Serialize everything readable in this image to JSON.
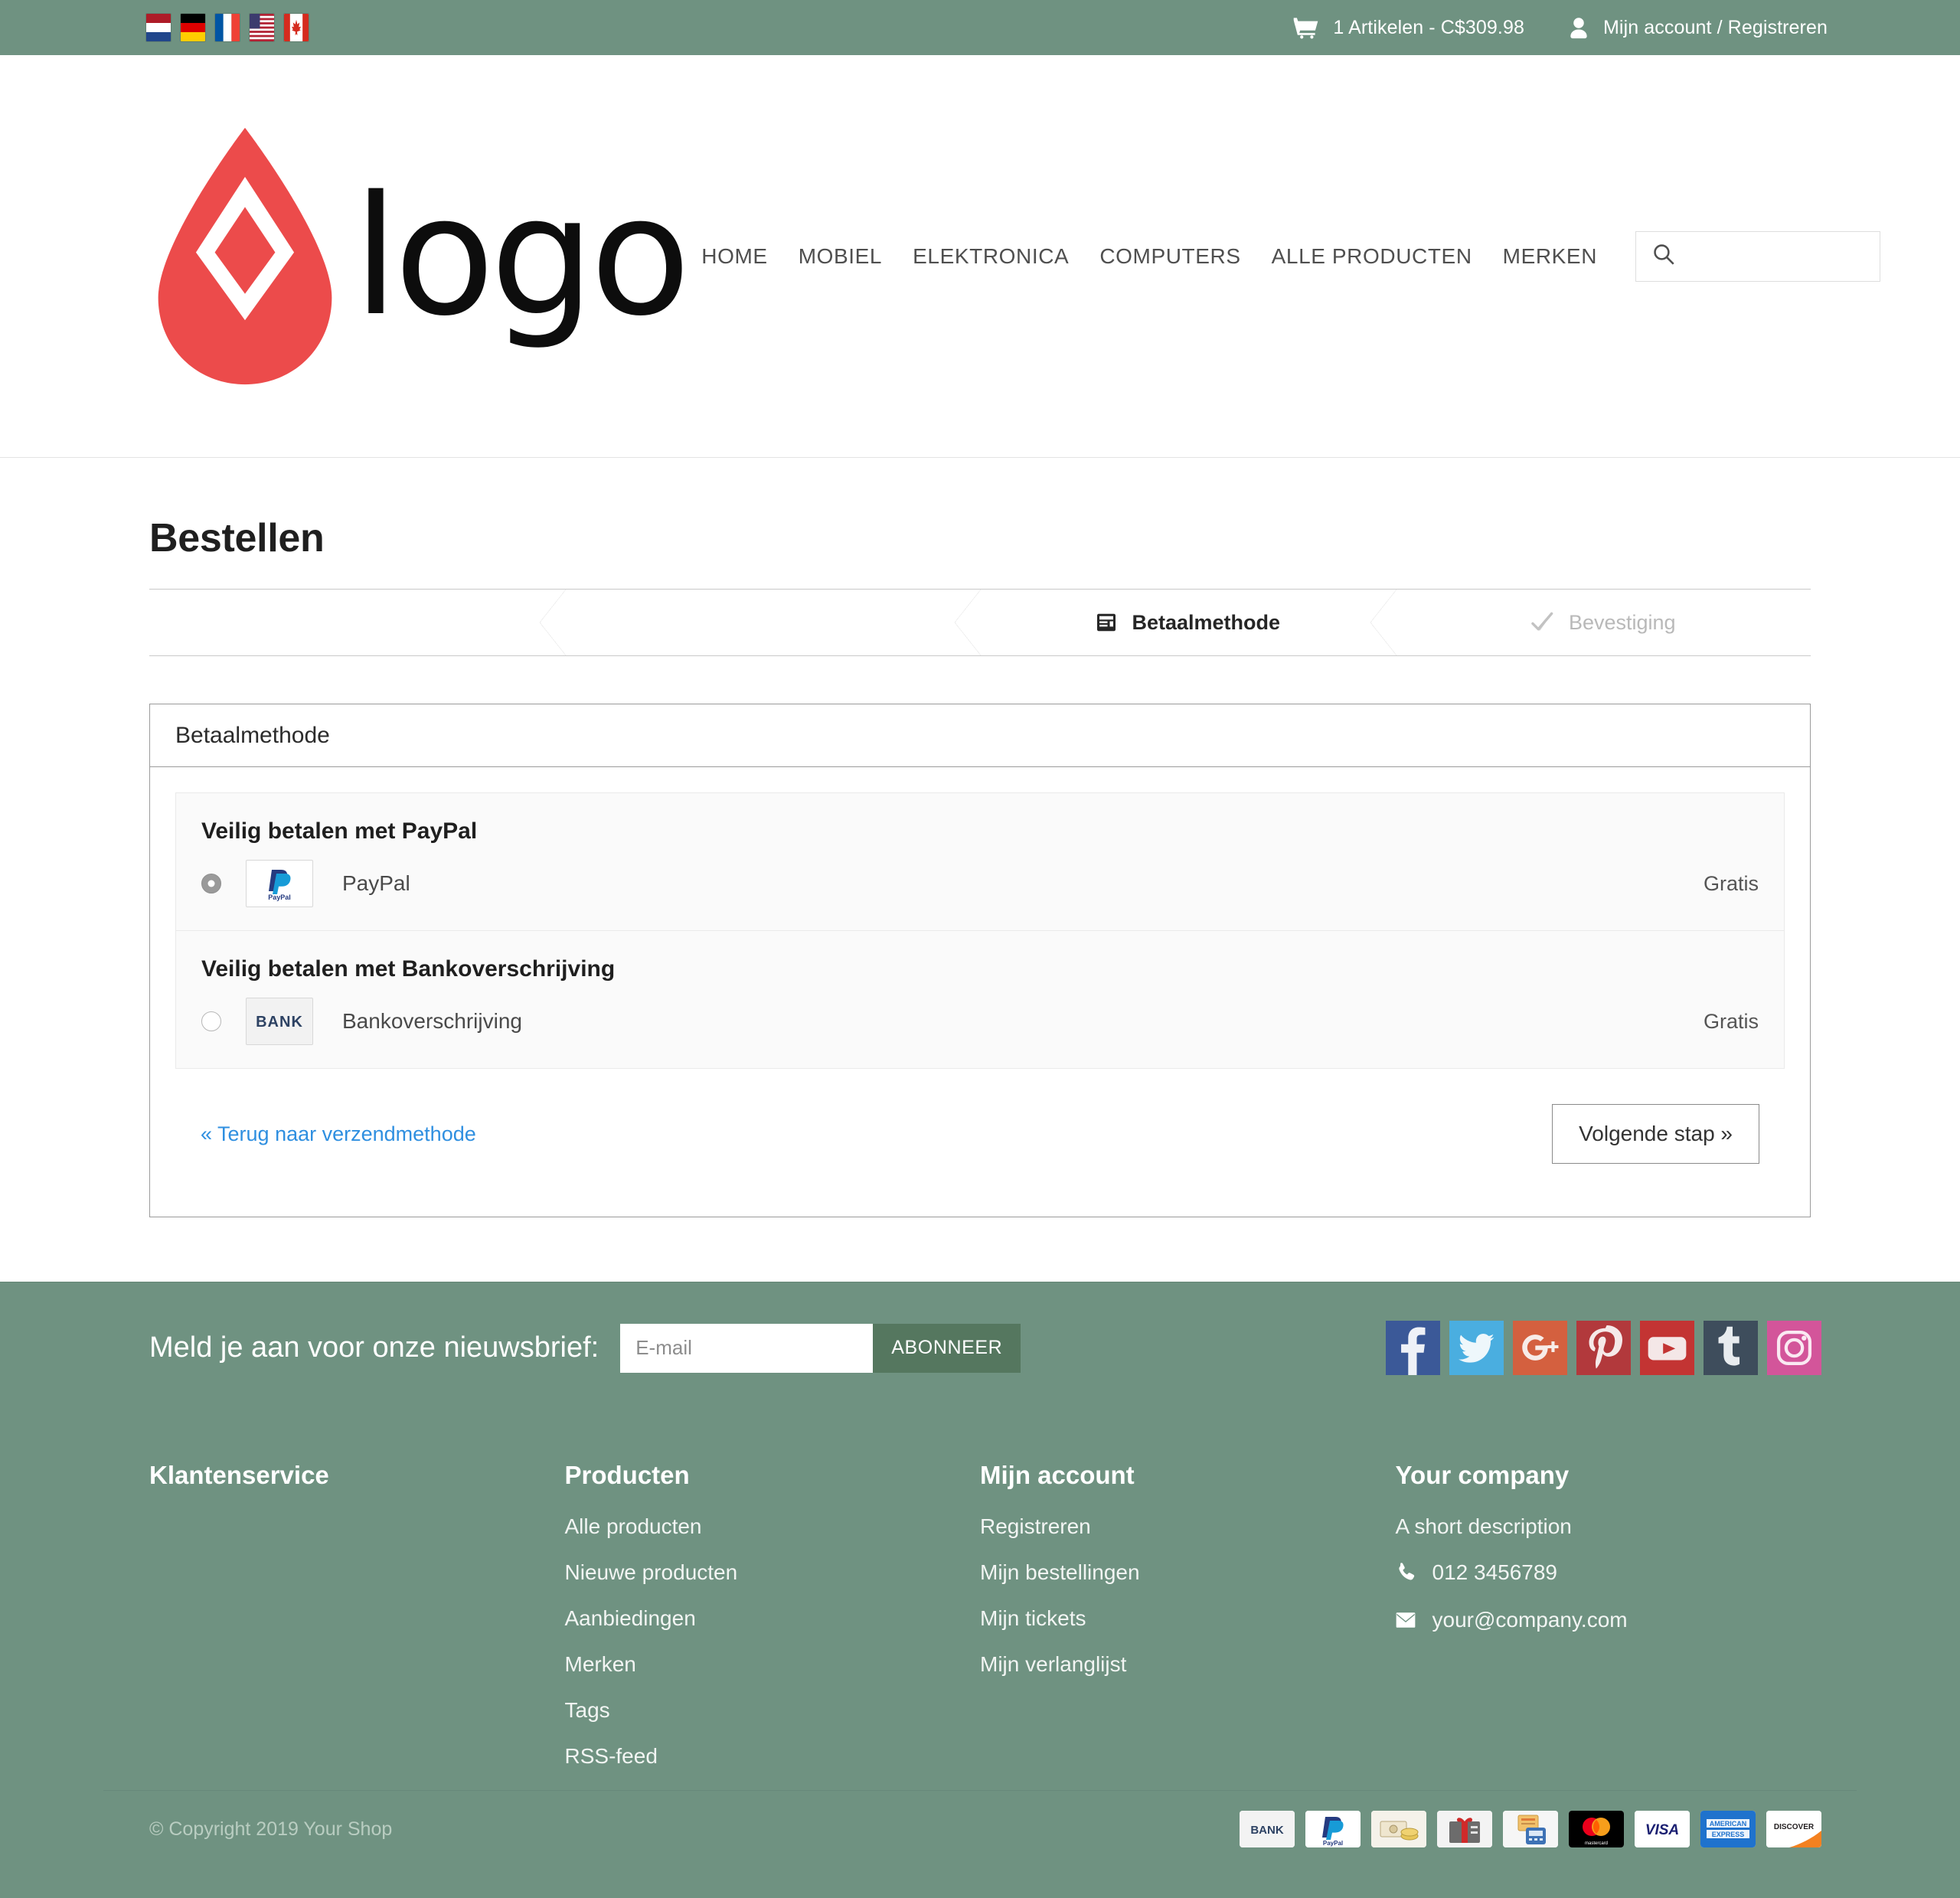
{
  "topbar": {
    "flags": [
      {
        "name": "flag-nl",
        "title": "Nederlands"
      },
      {
        "name": "flag-de",
        "title": "Deutsch"
      },
      {
        "name": "flag-fr",
        "title": "Français"
      },
      {
        "name": "flag-us",
        "title": "English"
      },
      {
        "name": "flag-ca",
        "title": "Canada"
      }
    ],
    "cart_icon": "cart-icon",
    "cart_text": "1 Artikelen - C$309.98",
    "account_icon": "user-icon",
    "account_text": "Mijn account / Registreren"
  },
  "header": {
    "logo_text": "logo",
    "logo_mark": "flame-logo-icon",
    "nav": [
      {
        "label": "HOME"
      },
      {
        "label": "MOBIEL"
      },
      {
        "label": "ELEKTRONICA"
      },
      {
        "label": "COMPUTERS"
      },
      {
        "label": "ALLE PRODUCTEN"
      },
      {
        "label": "MERKEN"
      }
    ],
    "search": {
      "icon": "search-icon",
      "placeholder": "",
      "value": ""
    }
  },
  "page": {
    "title": "Bestellen",
    "steps": [
      {
        "label": "",
        "state": "blank",
        "icon": ""
      },
      {
        "label": "",
        "state": "blank",
        "icon": ""
      },
      {
        "label": "Betaalmethode",
        "state": "active",
        "icon": "credit-card-icon"
      },
      {
        "label": "Bevestiging",
        "state": "muted",
        "icon": "check-icon"
      }
    ],
    "panel": {
      "heading": "Betaalmethode",
      "groups": [
        {
          "title": "Veilig betalen met PayPal",
          "methods": [
            {
              "id": "paypal",
              "label": "PayPal",
              "price": "Gratis",
              "selected": true,
              "logo": "paypal-logo",
              "logo_text": "PayPal"
            }
          ]
        },
        {
          "title": "Veilig betalen met Bankoverschrijving",
          "methods": [
            {
              "id": "bank",
              "label": "Bankoverschrijving",
              "price": "Gratis",
              "selected": false,
              "logo": "bank-logo",
              "logo_text": "BANK"
            }
          ]
        }
      ],
      "back_link": "« Terug naar verzendmethode",
      "next_button": "Volgende stap »"
    }
  },
  "newsletter": {
    "title": "Meld je aan voor onze nieuwsbrief:",
    "input_placeholder": "E-mail",
    "input_value": "",
    "button": "ABONNEER",
    "socials": [
      {
        "name": "facebook-icon",
        "color": "#3b5998"
      },
      {
        "name": "twitter-icon",
        "color": "#4aaee0"
      },
      {
        "name": "google-plus-icon",
        "color": "#d4603f"
      },
      {
        "name": "pinterest-icon",
        "color": "#b2393c"
      },
      {
        "name": "youtube-icon",
        "color": "#c33433"
      },
      {
        "name": "tumblr-icon",
        "color": "#3e4d5c"
      },
      {
        "name": "instagram-icon",
        "color": "#d3559a"
      }
    ]
  },
  "footer": {
    "columns": [
      {
        "heading": "Klantenservice",
        "links": []
      },
      {
        "heading": "Producten",
        "links": [
          "Alle producten",
          "Nieuwe producten",
          "Aanbiedingen",
          "Merken",
          "Tags",
          "RSS-feed"
        ]
      },
      {
        "heading": "Mijn account",
        "links": [
          "Registreren",
          "Mijn bestellingen",
          "Mijn tickets",
          "Mijn verlanglijst"
        ]
      }
    ],
    "company": {
      "heading": "Your company",
      "description": "A short description",
      "phone_icon": "phone-icon",
      "phone": "012 3456789",
      "email_icon": "envelope-icon",
      "email": "your@company.com"
    },
    "copyright": "© Copyright 2019 Your Shop",
    "payment_methods": [
      {
        "name": "bank-badge",
        "label": "BANK"
      },
      {
        "name": "paypal-badge",
        "label": "PayPal"
      },
      {
        "name": "cash-badge",
        "label": "Contant"
      },
      {
        "name": "gift-badge",
        "label": "Cadeaubon"
      },
      {
        "name": "terminal-badge",
        "label": "Pin"
      },
      {
        "name": "mastercard-badge",
        "label": "mastercard"
      },
      {
        "name": "visa-badge",
        "label": "VISA"
      },
      {
        "name": "amex-badge",
        "label": "AMERICAN EXPRESS"
      },
      {
        "name": "discover-badge",
        "label": "DISCOVER"
      }
    ]
  },
  "colors": {
    "brand_green": "#6f9281",
    "logo_red": "#ec4b4b",
    "link_blue": "#2f8fe0"
  }
}
